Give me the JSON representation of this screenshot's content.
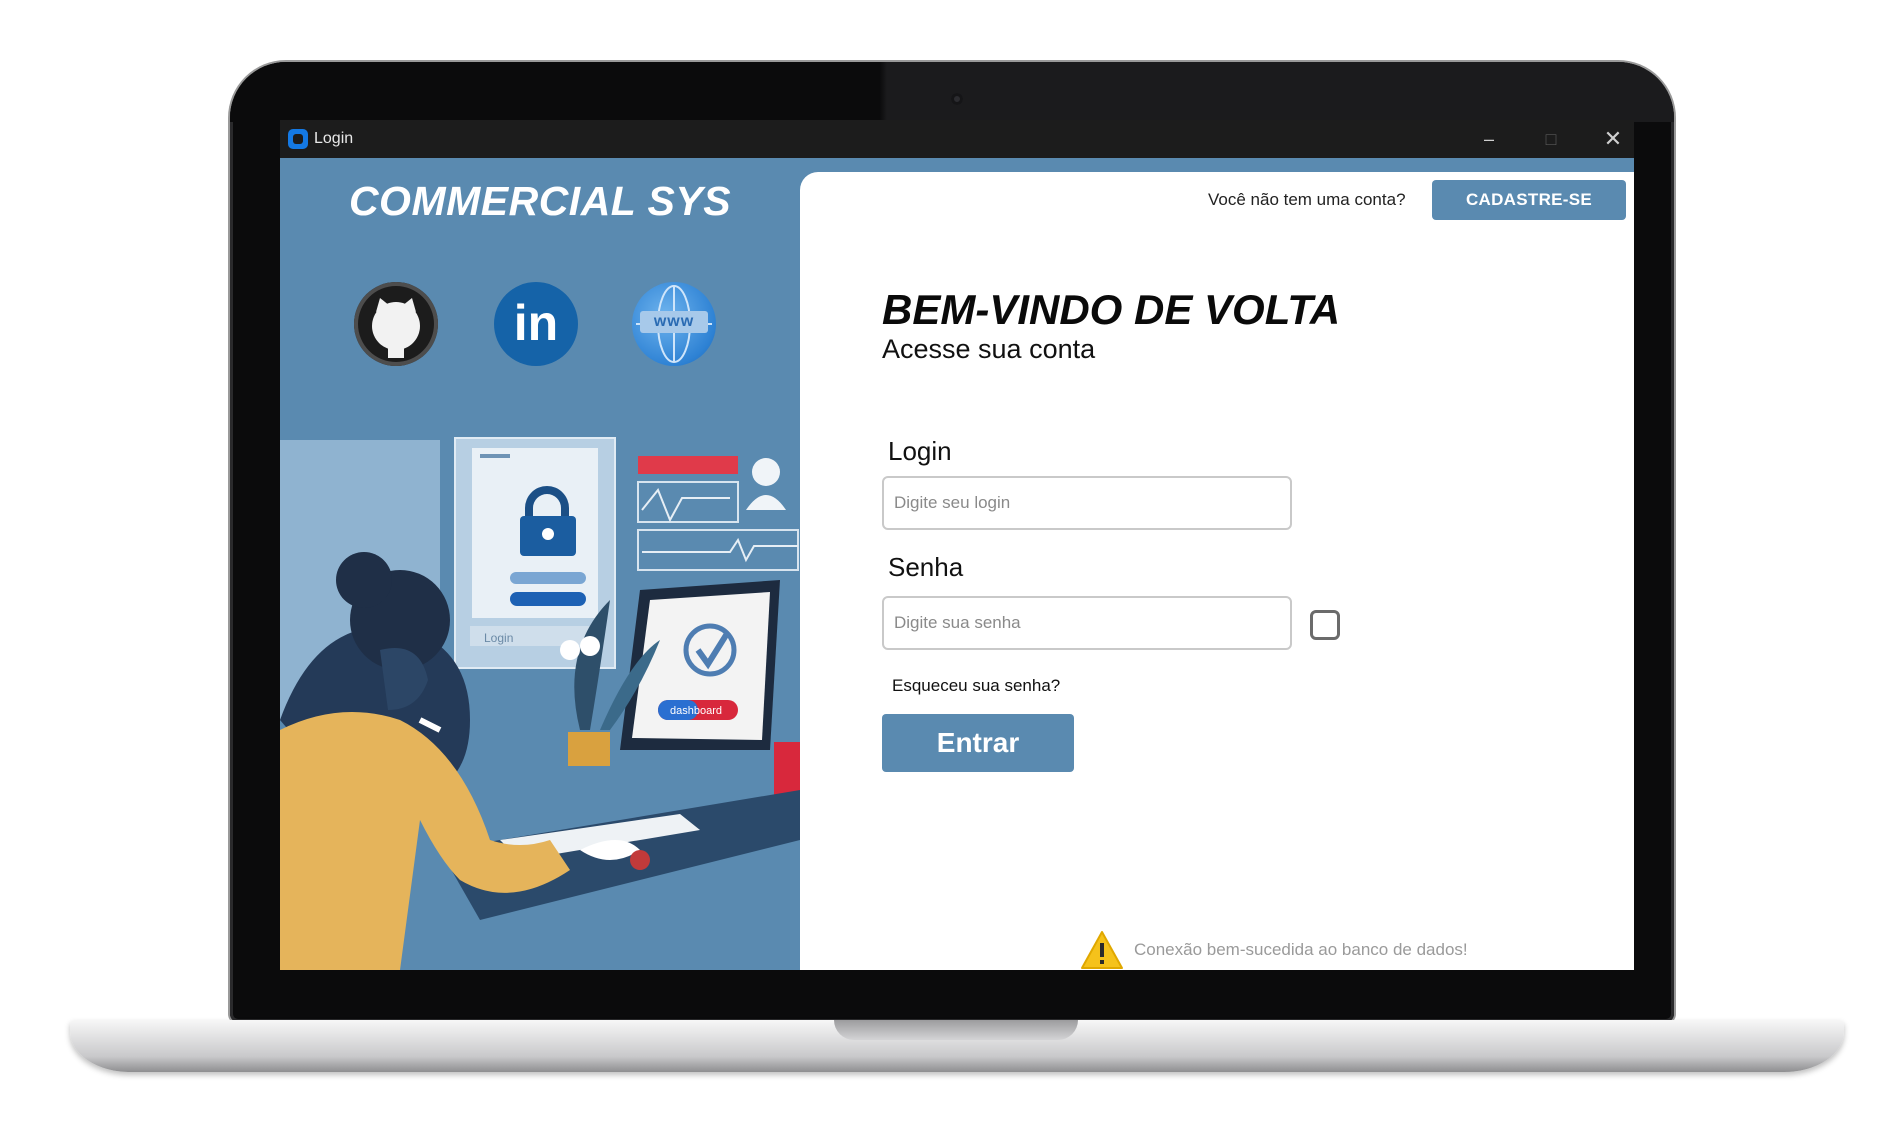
{
  "window": {
    "title": "Login",
    "controls": {
      "minimize": "–",
      "maximize": "□",
      "close": "✕"
    }
  },
  "left_panel": {
    "brand": "COMMERCIAL SYS",
    "social": [
      {
        "icon": "github-icon"
      },
      {
        "icon": "linkedin-icon",
        "text": "in"
      },
      {
        "icon": "website-icon",
        "text": "www"
      }
    ],
    "illustration": {
      "lock_card_label": "Login",
      "monitor_button_label": "dashboard"
    }
  },
  "header": {
    "no_account_text": "Você não tem uma conta?",
    "signup_label": "CADASTRE-SE"
  },
  "main": {
    "welcome_title": "BEM-VINDO DE VOLTA",
    "subtitle": "Acesse sua conta",
    "login_label": "Login",
    "login_placeholder": "Digite seu login",
    "password_label": "Senha",
    "password_placeholder": "Digite sua senha",
    "forgot_password": "Esqueceu sua senha?",
    "enter_label": "Entrar"
  },
  "status": {
    "message": "Conexão bem-sucedida ao banco de dados!",
    "icon": "warning-icon"
  },
  "colors": {
    "accent": "#5a8ab0",
    "titlebar": "#1c1c1c",
    "card": "#ffffff"
  }
}
